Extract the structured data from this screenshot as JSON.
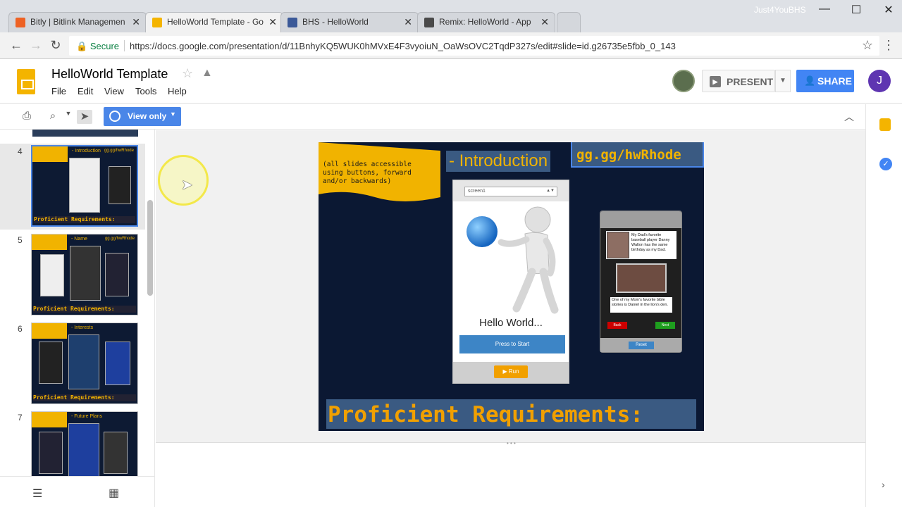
{
  "window": {
    "user": "Just4YouBHS",
    "controls": [
      "—",
      "☐",
      "✕"
    ]
  },
  "tabs": [
    {
      "label": "Bitly | Bitlink Managemen",
      "color": "#ee6123",
      "active": false
    },
    {
      "label": "HelloWorld Template - Go",
      "color": "#f4b400",
      "active": true
    },
    {
      "label": "BHS - HelloWorld",
      "color": "#3b5998",
      "active": false
    },
    {
      "label": "Remix: HelloWorld - App",
      "color": "#4a4a4a",
      "active": false
    }
  ],
  "addressbar": {
    "secure_label": "Secure",
    "url": "https://docs.google.com/presentation/d/11BnhyKQ5WUK0hMVxE4F3vyoiuN_OaWsOVC2TqdP327s/edit#slide=id.g26735e5fbb_0_143"
  },
  "header": {
    "doc_title": "HelloWorld Template",
    "menus": [
      "File",
      "Edit",
      "View",
      "Tools",
      "Help"
    ],
    "present_label": "PRESENT",
    "share_label": "SHARE",
    "user_initial": "J"
  },
  "toolbar": {
    "view_only_label": "View only"
  },
  "filmstrip": {
    "thumbnails": [
      {
        "number": "4",
        "title": "- Introduction",
        "link": "gg.gg/hwRhode",
        "footer": "Proficient Requirements:",
        "selected": true
      },
      {
        "number": "5",
        "title": "- Name",
        "link": "gg.gg/hwRhode",
        "footer": "Proficient Requirements:",
        "selected": false
      },
      {
        "number": "6",
        "title": "- Interests",
        "link": "",
        "footer": "Proficient Requirements:",
        "selected": false
      },
      {
        "number": "7",
        "title": "- Future Plans",
        "link": "",
        "footer": "",
        "selected": false
      }
    ]
  },
  "slide": {
    "banner_text": "(all slides accessible using buttons, forward and/or backwards)",
    "title": "- Introduction",
    "link": "gg.gg/hwRhode",
    "phone1": {
      "screen_select": "screen1",
      "hello_text": "Hello World...",
      "press_button": "Press to Start",
      "run_button": "▶ Run"
    },
    "phone2": {
      "card1_text": "My Dad's favorite baseball player Danny Walton has the same birthday as my Dad.",
      "card2_text": "One of my Mom's favorite bible stories is Daniel in the lion's den.",
      "back_button": "Back",
      "next_button": "Next",
      "reset_button": "Reset"
    },
    "footer": "Proficient Requirements:"
  },
  "colors": {
    "slide_bg": "#0b1833",
    "accent_gold": "#f1b300",
    "title_band": "#3a5a82",
    "google_blue": "#4285f4"
  }
}
